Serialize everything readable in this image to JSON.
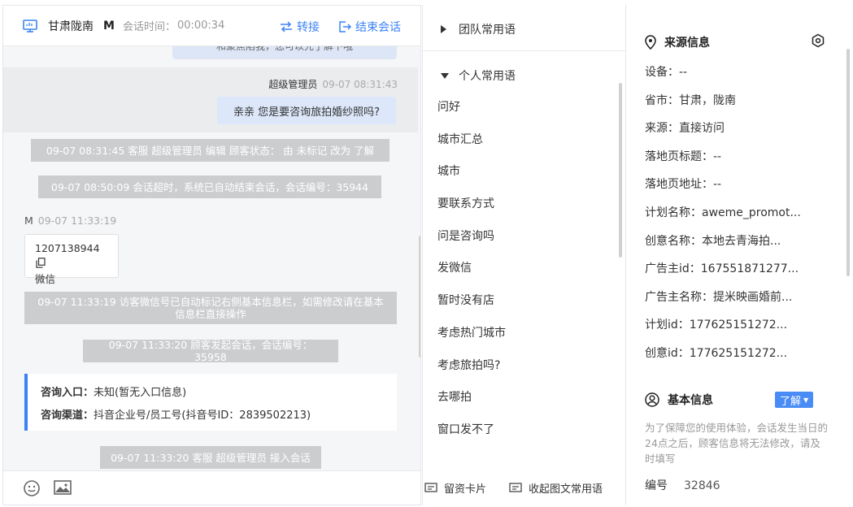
{
  "header": {
    "region": "甘肃陇南",
    "initial": "M",
    "session_time_label": "会话时间：",
    "session_time": "00:00:34",
    "transfer_label": "转接",
    "end_label": "结束会话"
  },
  "messages": {
    "top_bubble_partial": "和聚焦陷我，您可以先了解下哦",
    "agent_name": "超级管理员",
    "agent_time": "09-07 08:31:43",
    "agent_text": "亲亲 您是要咨询旅拍婚纱照吗?",
    "sys_1": "09-07 08:31:45 客服 超级管理员 编辑 顾客状态： 由 未标记 改为 了解",
    "sys_2": "09-07 08:50:09 会话超时，系统已自动结束会话，会话编号：35944",
    "visitor_name": "M",
    "visitor_time": "09-07 11:33:19",
    "wechat_number": "1207138944",
    "wechat_label": "微信",
    "sys_3": "09-07 11:33:19 访客微信号已自动标记右侧基本信息栏，如需修改请在基本信息栏直接操作",
    "sys_4": "09-07 11:33:20 顾客发起会话，会话编号：35958",
    "entry_key": "咨询入口：",
    "entry_value": "未知(暂无入口信息)",
    "channel_key": "咨询渠道：",
    "channel_value": "抖音企业号/员工号(抖音号ID：2839502213)",
    "sys_5": "09-07 11:33:20 客服 超级管理员 接入会话"
  },
  "phrases": {
    "team_label": "团队常用语",
    "personal_label": "个人常用语",
    "items": [
      "问好",
      "城市汇总",
      "城市",
      "要联系方式",
      "问是咨询吗",
      "发微信",
      "暂时没有店",
      "考虑热门城市",
      "考虑旅拍吗?",
      "去哪拍",
      "窗口发不了"
    ],
    "contact_card_label": "留资卡片",
    "image_phrases_label": "收起图文常用语"
  },
  "info": {
    "source_title": "来源信息",
    "fields": [
      "设备：--",
      "省市：甘肃，陇南",
      "来源：直接访问",
      "落地页标题：--",
      "落地页地址：--",
      "计划名称：aweme_promot...",
      "创意名称：本地去青海拍...",
      "广告主id：167551871277...",
      "广告主名称：提米映画婚前...",
      "计划id：177625151272...",
      "创意id：177625151272..."
    ],
    "basic_title": "基本信息",
    "status_tag": "了解",
    "note": "为了保障您的使用体验，会话发生当日的24点之后，顾客信息将无法修改，请及时填写",
    "id_label": "编号",
    "id_value": "32846"
  },
  "colors": {
    "accent": "#3b82f6",
    "system_note_bg": "#cccdcf",
    "agent_bubble": "#dce7f9"
  }
}
